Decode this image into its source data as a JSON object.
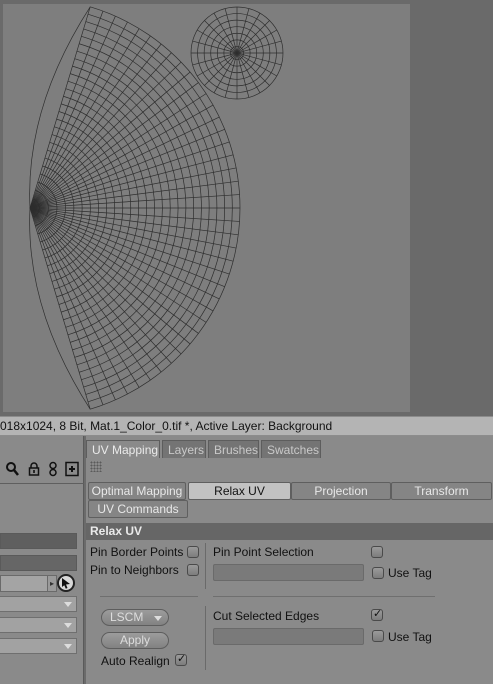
{
  "status_bar": {
    "text": "018x1024, 8 Bit, Mat.1_Color_0.tif *, Active Layer: Background"
  },
  "tabs": [
    {
      "label": "UV Mapping",
      "active": true
    },
    {
      "label": "Layers",
      "active": false
    },
    {
      "label": "Brushes",
      "active": false
    },
    {
      "label": "Swatches",
      "active": false
    }
  ],
  "subtabs": [
    {
      "label": "Optimal Mapping",
      "active": false
    },
    {
      "label": "Relax UV",
      "active": true
    },
    {
      "label": "Projection",
      "active": false
    },
    {
      "label": "Transform",
      "active": false
    },
    {
      "label": "UV Commands",
      "active": false
    }
  ],
  "relax": {
    "section_title": "Relax UV",
    "pin_border_points": {
      "label": "Pin Border Points",
      "checked": false
    },
    "pin_to_neighbors": {
      "label": "Pin to Neighbors",
      "checked": false
    },
    "pin_point_selection": {
      "label": "Pin Point Selection",
      "checked": false,
      "value": ""
    },
    "pin_use_tag": {
      "label": "Use Tag",
      "checked": false
    },
    "method": {
      "value": "LSCM"
    },
    "apply_label": "Apply",
    "auto_realign": {
      "label": "Auto Realign",
      "checked": true
    },
    "cut_selected_edges": {
      "label": "Cut Selected Edges",
      "checked": true,
      "value": ""
    },
    "cut_use_tag": {
      "label": "Use Tag",
      "checked": false
    }
  },
  "left_toolbar": {
    "icons": [
      "search-icon",
      "lock-icon",
      "link-icon",
      "add-layer-icon"
    ]
  },
  "colors": {
    "canvas": "#7e7e7e",
    "mesh_line": "#2e2e2e",
    "panel": "#8a8a8a",
    "section_header": "#666666"
  }
}
